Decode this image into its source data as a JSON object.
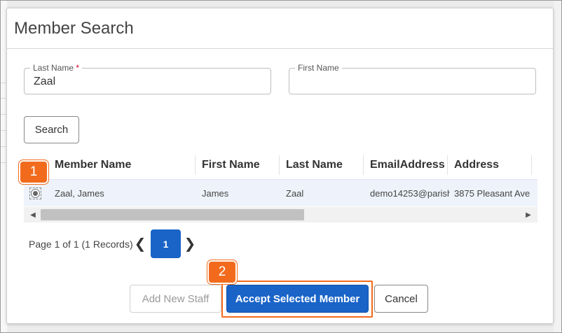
{
  "modal": {
    "title": "Member Search"
  },
  "form": {
    "last_name": {
      "label": "Last Name",
      "required_marker": "*",
      "value": "Zaal"
    },
    "first_name": {
      "label": "First Name",
      "value": ""
    },
    "search_label": "Search"
  },
  "grid": {
    "columns": [
      "Member Name",
      "First Name",
      "Last Name",
      "EmailAddress",
      "Address"
    ],
    "rows": [
      {
        "selected": true,
        "member_name": "Zaal, James",
        "first_name": "James",
        "last_name": "Zaal",
        "email": "demo14253@parish",
        "address": "3875 Pleasant Ave"
      }
    ]
  },
  "pager": {
    "summary": "Page 1 of 1 (1 Records)",
    "current_page": "1"
  },
  "actions": {
    "add_new_staff": "Add New Staff",
    "accept_selected_member": "Accept Selected Member",
    "cancel": "Cancel"
  },
  "callouts": [
    "1",
    "2"
  ],
  "colors": {
    "primary": "#1a64c8",
    "callout": "#f26b1d",
    "selected_row": "#eef3fb",
    "required": "#d0021b"
  },
  "icons": {
    "pager_prev": "chevron-left-icon",
    "pager_next": "chevron-right-icon",
    "scroll_left": "triangle-left-icon",
    "scroll_right": "triangle-right-icon"
  }
}
